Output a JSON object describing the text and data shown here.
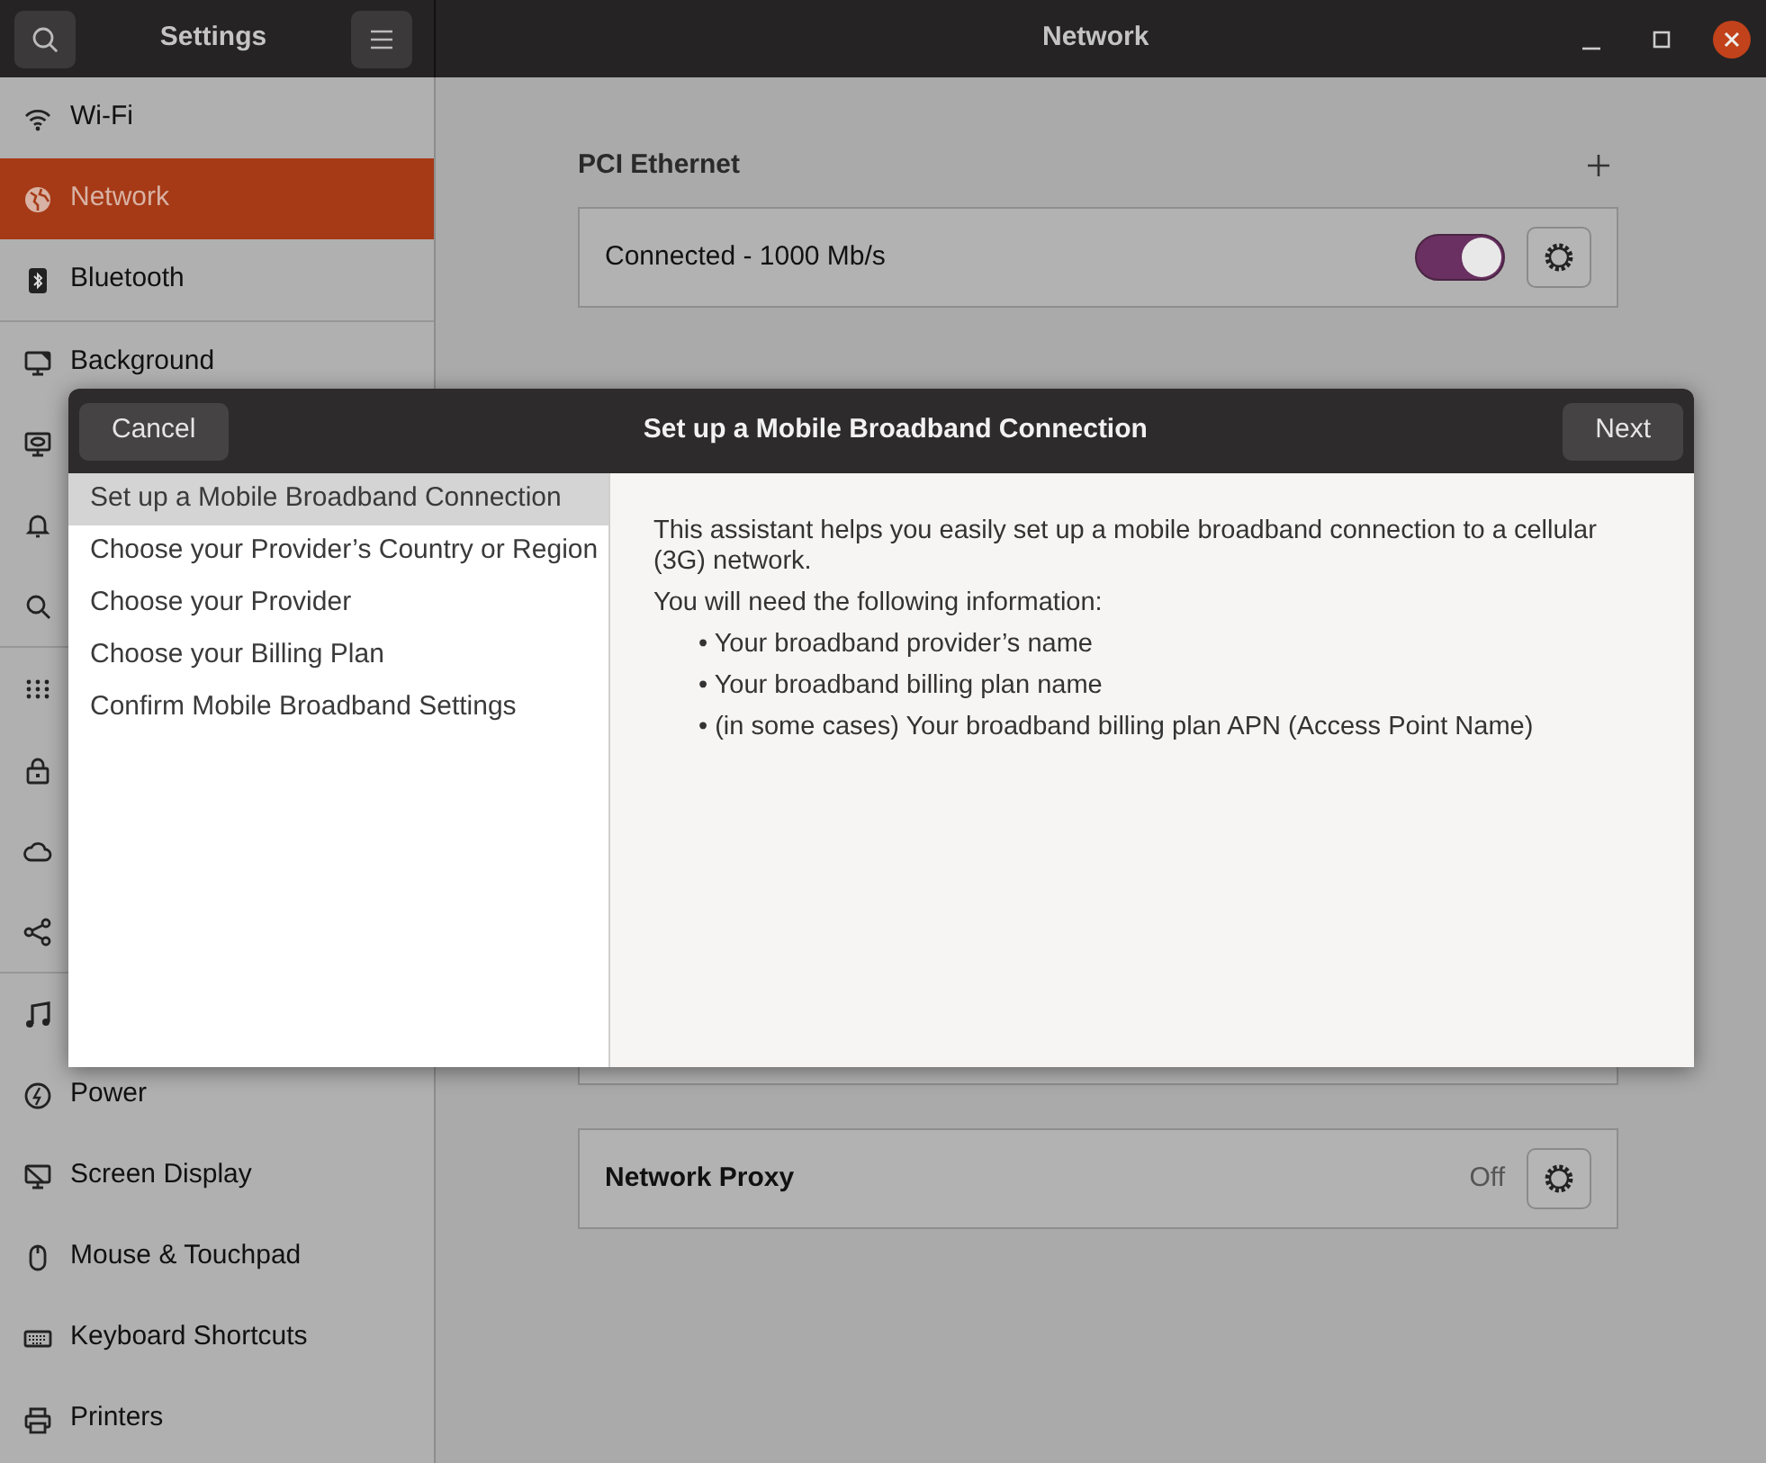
{
  "window": {
    "title": "Settings",
    "page_title": "Network"
  },
  "sidebar": {
    "groups": [
      {
        "items": [
          {
            "label": "Wi-Fi",
            "selected": false
          },
          {
            "label": "Network",
            "selected": true
          },
          {
            "label": "Bluetooth",
            "selected": false
          }
        ]
      },
      {
        "items": [
          {
            "label": "Background",
            "selected": false
          },
          {
            "selected": false
          },
          {
            "selected": false
          },
          {
            "selected": false
          }
        ]
      },
      {
        "items": [
          {
            "selected": false
          },
          {
            "selected": false
          },
          {
            "selected": false
          },
          {
            "selected": false
          }
        ]
      },
      {
        "items": [
          {
            "selected": false
          },
          {
            "label": "Power",
            "selected": false
          },
          {
            "label": "Screen Display",
            "selected": false
          },
          {
            "label": "Mouse & Touchpad",
            "selected": false
          },
          {
            "label": "Keyboard Shortcuts",
            "selected": false
          },
          {
            "label": "Printers",
            "selected": false
          }
        ]
      }
    ]
  },
  "ethernet": {
    "heading": "PCI Ethernet",
    "status": "Connected - 1000 Mb/s",
    "on": true
  },
  "proxy": {
    "label": "Network Proxy",
    "value": "Off"
  },
  "dialog": {
    "title": "Set up a Mobile Broadband Connection",
    "cancel": "Cancel",
    "next": "Next",
    "steps": [
      {
        "label": "Set up a Mobile Broadband Connection",
        "selected": true
      },
      {
        "label": "Choose your Provider’s Country or Region",
        "selected": false
      },
      {
        "label": "Choose your Provider",
        "selected": false
      },
      {
        "label": "Choose your Billing Plan",
        "selected": false
      },
      {
        "label": "Confirm Mobile Broadband Settings",
        "selected": false
      }
    ],
    "intro": "This assistant helps you easily set up a mobile broadband connection to a cellular (3G) network.",
    "lead": "You will need the following information:",
    "bullets": [
      "• Your broadband provider’s name",
      "• Your broadband billing plan name",
      "• (in some cases) Your broadband billing plan APN (Access Point Name)"
    ]
  }
}
